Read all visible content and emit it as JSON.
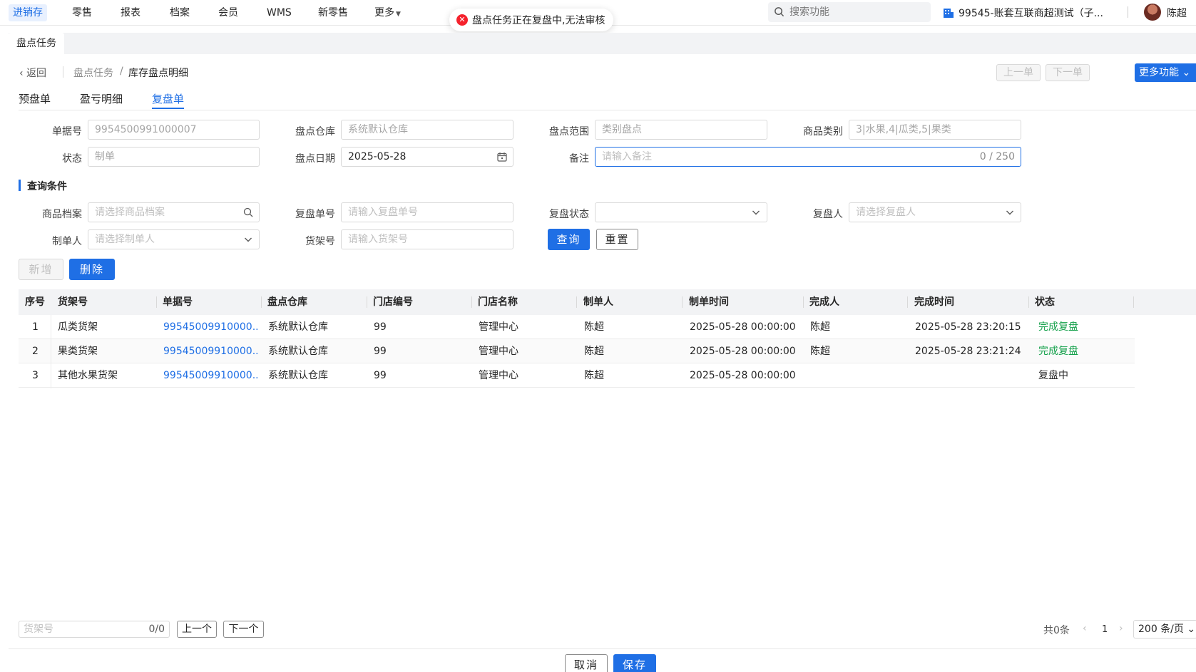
{
  "nav": {
    "items": [
      "进销存",
      "零售",
      "报表",
      "档案",
      "会员",
      "WMS",
      "新零售"
    ],
    "more": "更多",
    "search_placeholder": "搜索功能",
    "org": "99545-账套互联商超测试（子...",
    "user": "陈超"
  },
  "toast": {
    "message": "盘点任务正在复盘中,无法审核"
  },
  "page_tab": "盘点任务",
  "breadcrumb": {
    "back": "返回",
    "parent": "盘点任务",
    "sep": "/",
    "current": "库存盘点明细"
  },
  "header_buttons": {
    "prev": "上一单",
    "next": "下一单",
    "more": "更多功能"
  },
  "subtabs": [
    "预盘单",
    "盈亏明细",
    "复盘单"
  ],
  "form": {
    "doc_no": {
      "label": "单据号",
      "value": "9954500991000007"
    },
    "warehouse": {
      "label": "盘点仓库",
      "value": "系统默认仓库"
    },
    "scope": {
      "label": "盘点范围",
      "value": "类别盘点"
    },
    "category": {
      "label": "商品类别",
      "value": "3|水果,4|瓜类,5|果类"
    },
    "status": {
      "label": "状态",
      "value": "制单"
    },
    "date": {
      "label": "盘点日期",
      "value": "2025-05-28"
    },
    "remark": {
      "label": "备注",
      "placeholder": "请输入备注",
      "counter": "0 / 250"
    }
  },
  "query": {
    "title": "查询条件",
    "product": {
      "label": "商品档案",
      "placeholder": "请选择商品档案"
    },
    "recheck_no": {
      "label": "复盘单号",
      "placeholder": "请输入复盘单号"
    },
    "recheck_status": {
      "label": "复盘状态",
      "placeholder": ""
    },
    "rechecker": {
      "label": "复盘人",
      "placeholder": "请选择复盘人"
    },
    "creator": {
      "label": "制单人",
      "placeholder": "请选择制单人"
    },
    "shelf": {
      "label": "货架号",
      "placeholder": "请输入货架号"
    },
    "search_btn": "查询",
    "reset_btn": "重置"
  },
  "actions": {
    "add": "新增",
    "delete": "删除"
  },
  "table": {
    "headers": [
      "序号",
      "货架号",
      "单据号",
      "盘点仓库",
      "门店编号",
      "门店名称",
      "制单人",
      "制单时间",
      "完成人",
      "完成时间",
      "状态"
    ],
    "rows": [
      [
        "1",
        "瓜类货架",
        "99545009910000...",
        "系统默认仓库",
        "99",
        "管理中心",
        "陈超",
        "2025-05-28 00:00:00",
        "陈超",
        "2025-05-28 23:20:15",
        "完成复盘"
      ],
      [
        "2",
        "果类货架",
        "99545009910000...",
        "系统默认仓库",
        "99",
        "管理中心",
        "陈超",
        "2025-05-28 00:00:00",
        "陈超",
        "2025-05-28 23:21:24",
        "完成复盘"
      ],
      [
        "3",
        "其他水果货架",
        "99545009910000...",
        "系统默认仓库",
        "99",
        "管理中心",
        "陈超",
        "2025-05-28 00:00:00",
        "",
        "",
        "复盘中"
      ]
    ]
  },
  "bottom": {
    "shelf_placeholder": "货架号",
    "shelf_counter": "0/0",
    "prev": "上一个",
    "next": "下一个",
    "total": "共0条",
    "page": "1",
    "page_size": "200 条/页"
  },
  "footer": {
    "cancel": "取消",
    "save": "保存"
  },
  "colors": {
    "accent": "#1f6fe5",
    "done": "#13a04a",
    "error": "#f5222d"
  }
}
